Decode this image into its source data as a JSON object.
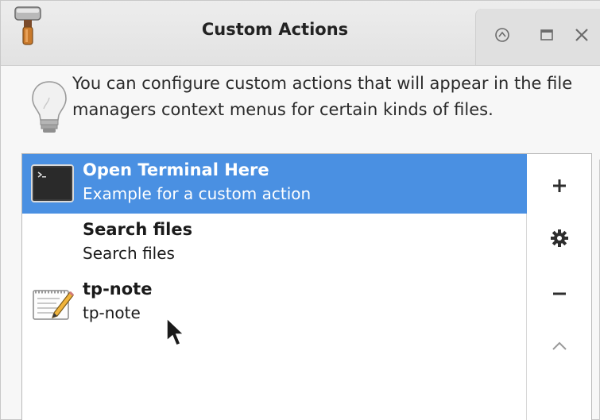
{
  "window": {
    "title": "Custom Actions",
    "app_icon": "thunar-brush-icon",
    "controls": [
      "shade-icon",
      "maximize-icon",
      "close-icon"
    ]
  },
  "info": {
    "icon": "lightbulb-icon",
    "text": "You can configure custom actions that will appear in the file managers context menus for certain kinds of files."
  },
  "actions": [
    {
      "name": "Open Terminal Here",
      "description": "Example for a custom action",
      "icon": "terminal-icon",
      "selected": true
    },
    {
      "name": "Search files",
      "description": "Search files",
      "icon": "",
      "selected": false
    },
    {
      "name": "tp-note",
      "description": "tp-note",
      "icon": "text-editor-icon",
      "selected": false
    }
  ],
  "side_buttons": [
    {
      "name": "add-action-button",
      "icon": "plus-icon",
      "enabled": true
    },
    {
      "name": "edit-action-button",
      "icon": "gear-icon",
      "enabled": true
    },
    {
      "name": "delete-action-button",
      "icon": "minus-icon",
      "enabled": true
    },
    {
      "name": "move-up-button",
      "icon": "chevron-up-icon",
      "enabled": false
    }
  ],
  "colors": {
    "selection": "#4a90e2",
    "disabled": "#9a9a9a"
  }
}
